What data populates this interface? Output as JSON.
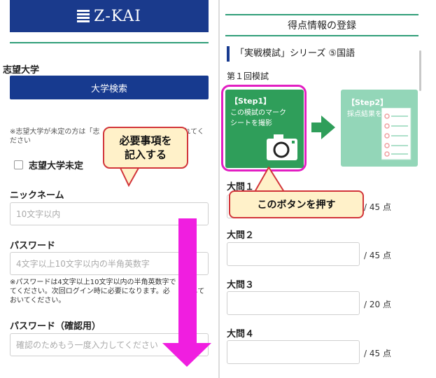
{
  "left": {
    "logo_text": "Z-KAI",
    "univ_label": "志望大学",
    "univ_button": "大学検索",
    "univ_note": "※志望大学が未定の方は「志　　　　　　　　　　　　れてください",
    "univ_undecided": "志望大学未定",
    "nickname_label": "ニックネーム",
    "nickname_placeholder": "10文字以内",
    "password_label": "パスワード",
    "password_placeholder": "4文字以上10文字以内の半角英数字",
    "password_note": "※パスワードは4文字以上10文字以内の半角英数字で　　　　てください。次回ログイン時に必要になります。必　　　しておいてください。",
    "confirm_label": "パスワード（確認用）",
    "confirm_placeholder": "確認のためもう一度入力してください",
    "callout_line1": "必要事項を",
    "callout_line2": "記入する"
  },
  "right": {
    "title": "得点情報の登録",
    "series": "「実戦模試」シリーズ ⑤国語",
    "round": "第１回模試",
    "step1_title": "【Step1】",
    "step1_text": "この模試のマークシートを撮影",
    "step2_title": "【Step2】",
    "step2_text": "採点結果を表示",
    "callout": "このボタンを押す",
    "questions": [
      {
        "label": "大問１",
        "max": "/ 45 点"
      },
      {
        "label": "大問２",
        "max": "/ 45 点"
      },
      {
        "label": "大問３",
        "max": "/ 20 点"
      },
      {
        "label": "大問４",
        "max": "/ 45 点"
      }
    ]
  },
  "colors": {
    "navy": "#173a8f",
    "green": "#2f9e5a",
    "light_green": "#93d6b8",
    "callout_fill": "#fff1c9",
    "callout_border": "#d2353a",
    "magenta": "#e21ec2"
  },
  "icons": [
    "logo-mark-icon",
    "camera-icon",
    "arrow-right-icon",
    "mark-sheet-icon",
    "arrow-down-icon"
  ]
}
